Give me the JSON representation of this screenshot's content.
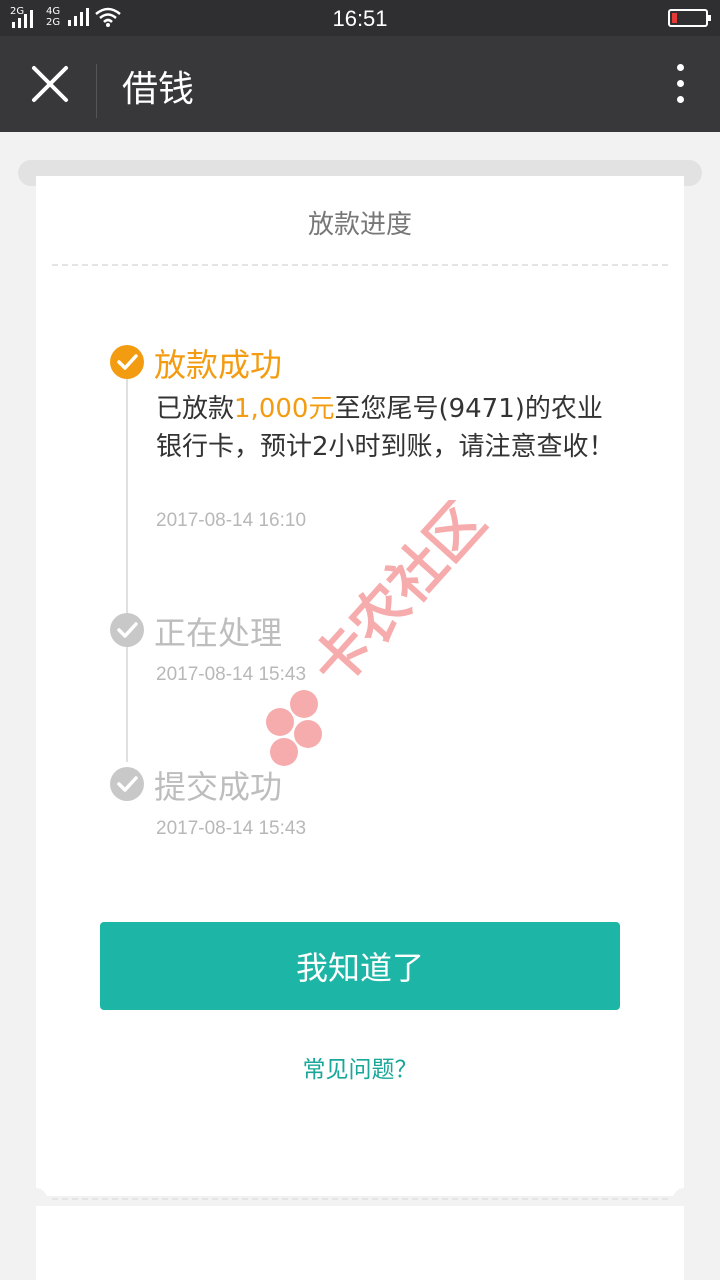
{
  "status_bar": {
    "sim1": "2G",
    "sim2_top": "4G",
    "sim2_bottom": "2G",
    "time": "16:51",
    "icons": [
      "signal-icon",
      "wifi-icon",
      "battery-low-icon"
    ],
    "battery_level": 0.15,
    "battery_color": "#e53935"
  },
  "navbar": {
    "title": "借钱",
    "close_icon": "close-icon",
    "more_icon": "more-vertical-icon"
  },
  "card": {
    "title": "放款进度"
  },
  "steps": [
    {
      "title": "放款成功",
      "desc_prefix": "已放款",
      "amount": "1,000元",
      "desc_suffix": "至您尾号(9471)的农业银行卡，预计2小时到账，请注意查收！",
      "time": "2017-08-14 16:10",
      "state": "active",
      "color": "#f39c12"
    },
    {
      "title": "正在处理",
      "time": "2017-08-14 15:43",
      "state": "done",
      "color": "#c8c8c8"
    },
    {
      "title": "提交成功",
      "time": "2017-08-14 15:43",
      "state": "done",
      "color": "#c8c8c8"
    }
  ],
  "watermark_text": "卡农社区",
  "ok_button": "我知道了",
  "faq_link": "常见问题？",
  "colors": {
    "accent": "#1db5a6",
    "highlight": "#f39c12",
    "navbar": "#38383a"
  }
}
